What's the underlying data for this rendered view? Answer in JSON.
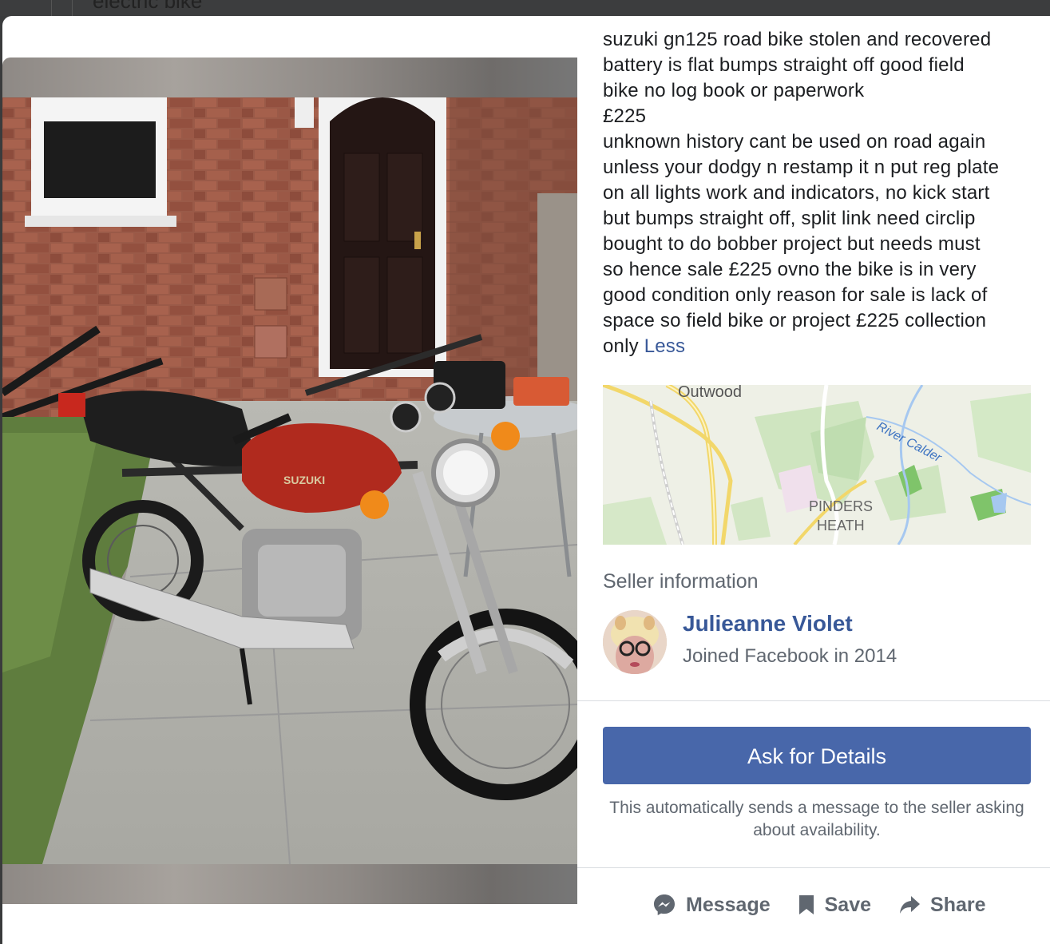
{
  "background": {
    "search_text": "electric bike"
  },
  "listing": {
    "description_lines": [
      "suzuki gn125 road bike stolen and recovered",
      "battery is flat bumps straight off good field",
      "bike no log book or paperwork",
      "£225",
      "unknown history cant be used on road again",
      "unless your dodgy n restamp it n put reg plate",
      "on all lights work and indicators, no kick start",
      "but bumps straight off, split link need circlip",
      "bought to do bobber project but needs must",
      "so hence sale £225 ovno the bike is in very",
      "good condition only reason for sale is lack of",
      "space so field bike or project £225 collection"
    ],
    "last_line": "only",
    "less_link": "Less"
  },
  "map": {
    "labels": {
      "outwood": "Outwood",
      "river": "River Calder",
      "pinders_line1": "PINDERS",
      "pinders_line2": "HEATH"
    }
  },
  "seller": {
    "heading": "Seller information",
    "name": "Julieanne Violet",
    "joined": "Joined Facebook in 2014"
  },
  "cta": {
    "ask_label": "Ask for Details",
    "note": "This automatically sends a message to the seller asking about availability."
  },
  "actions": {
    "message": "Message",
    "save": "Save",
    "share": "Share"
  },
  "photo": {
    "tank_brand": "SUZUKI"
  },
  "colors": {
    "link": "#385898",
    "button": "#4867aa",
    "secondary_text": "#606770"
  }
}
